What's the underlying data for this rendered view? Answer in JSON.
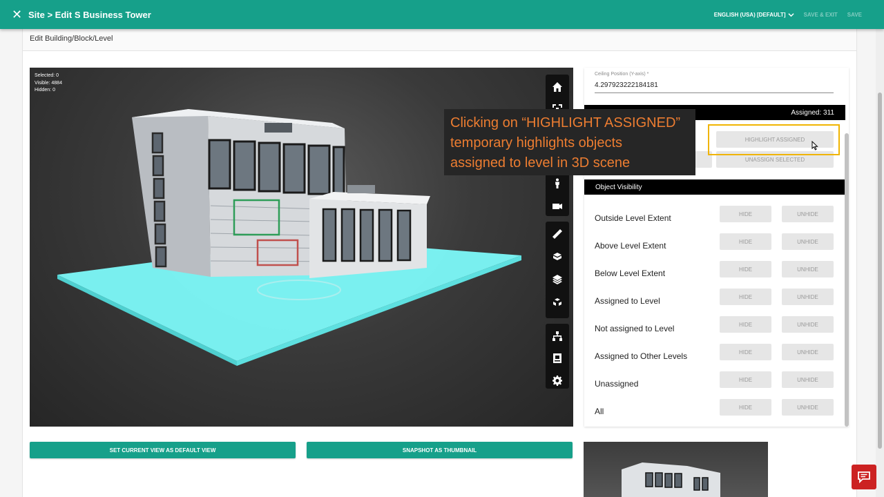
{
  "header": {
    "title": "Site > Edit S Business Tower",
    "language": "ENGLISH (USA) [DEFAULT]",
    "save_exit": "SAVE & EXIT",
    "save": "SAVE"
  },
  "card": {
    "title": "Edit Building/Block/Level"
  },
  "viewer": {
    "selected": "Selected: 0",
    "visible": "Visible: 4884",
    "hidden": "Hidden: 0"
  },
  "toolbar_icons": [
    "home-icon",
    "focus-icon",
    "person-icon",
    "camera-icon",
    "ruler-icon",
    "section-box-icon",
    "layers-icon",
    "explode-icon",
    "hierarchy-icon",
    "properties-icon",
    "settings-icon"
  ],
  "buttons": {
    "set_default_view": "SET CURRENT VIEW AS DEFAULT VIEW",
    "snapshot_thumbnail": "SNAPSHOT AS THUMBNAIL"
  },
  "panel": {
    "ceiling_label": "Ceiling Position (Y-axis) *",
    "ceiling_value": "4.297923222184181",
    "assigned": "Assigned: 311",
    "highlight_assigned": "HIGHLIGHT ASSIGNED",
    "unassign_selected": "UNASSIGN SELECTED",
    "object_visibility": "Object Visibility",
    "hide_label": "HIDE",
    "unhide_label": "UNHIDE",
    "rows": [
      "Outside Level Extent",
      "Above Level Extent",
      "Below Level Extent",
      "Assigned to Level",
      "Not assigned to Level",
      "Assigned to Other Levels",
      "Unassigned",
      "All"
    ]
  },
  "callout": {
    "line1": "Clicking on “HIGHLIGHT ASSIGNED”",
    "line2": "temporary highlights objects",
    "line3": "assigned to level in 3D scene"
  },
  "colors": {
    "primary": "#16a08a",
    "callout_text": "#ed7d31",
    "highlight_frame": "#f0b400",
    "ground_highlight": "#7fffff"
  }
}
